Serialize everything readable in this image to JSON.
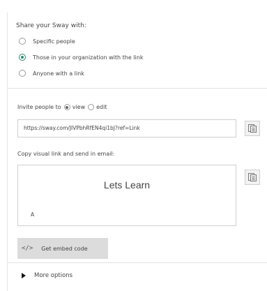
{
  "share": {
    "heading": "Share your Sway with:",
    "options": [
      {
        "label": "Specific people",
        "checked": false
      },
      {
        "label": "Those in your organization with the link",
        "checked": true
      },
      {
        "label": "Anyone with a link",
        "checked": false
      }
    ]
  },
  "invite": {
    "label": "Invite people to",
    "view_label": "view",
    "edit_label": "edit",
    "selected": "view"
  },
  "link": {
    "url": "https://sway.com/JIVPbhRfEN4qi1bJ?ref=Link"
  },
  "visual": {
    "label": "Copy visual link and send in email:",
    "title": "Lets Learn",
    "subtitle": "A"
  },
  "embed": {
    "icon": "</>",
    "label": "Get embed code"
  },
  "more": {
    "label": "More options"
  },
  "colors": {
    "accent": "#2a8a70",
    "button_bg": "#dcdcdc"
  }
}
